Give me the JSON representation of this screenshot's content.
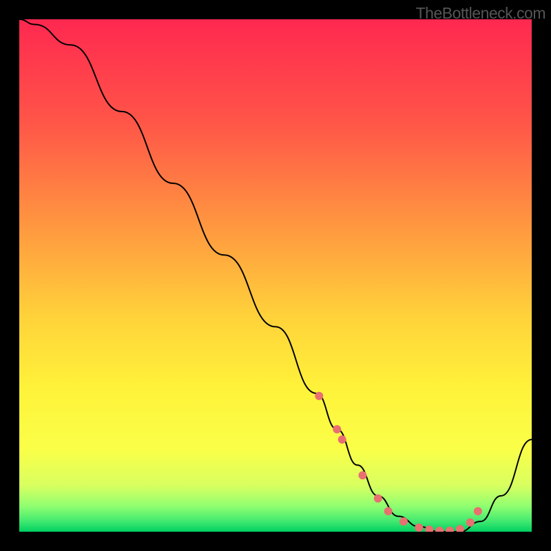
{
  "watermark": "TheBottleneck.com",
  "chart_data": {
    "type": "line",
    "xlim": [
      0,
      100
    ],
    "ylim": [
      0,
      100
    ],
    "x": [
      0,
      3,
      10,
      20,
      30,
      40,
      50,
      58,
      62,
      66,
      70,
      74,
      78,
      82,
      86,
      90,
      94,
      100
    ],
    "y": [
      100,
      99,
      95,
      82,
      68,
      54,
      40,
      27,
      20,
      13,
      7,
      3,
      1,
      0,
      0,
      2,
      7,
      18
    ],
    "markers": {
      "x": [
        58.5,
        62,
        63,
        67,
        70,
        72,
        75,
        78,
        80,
        82,
        84,
        86,
        88,
        89.5
      ],
      "y": [
        26.5,
        20,
        18,
        11,
        6.5,
        4,
        2,
        0.8,
        0.4,
        0.2,
        0.2,
        0.5,
        1.8,
        4
      ]
    },
    "gradient_colors": {
      "top": "#ff2850",
      "mid1": "#ff6b3d",
      "mid2": "#ffb83d",
      "mid3": "#ffe83d",
      "mid4": "#ffff40",
      "bottom": "#00d860"
    }
  }
}
